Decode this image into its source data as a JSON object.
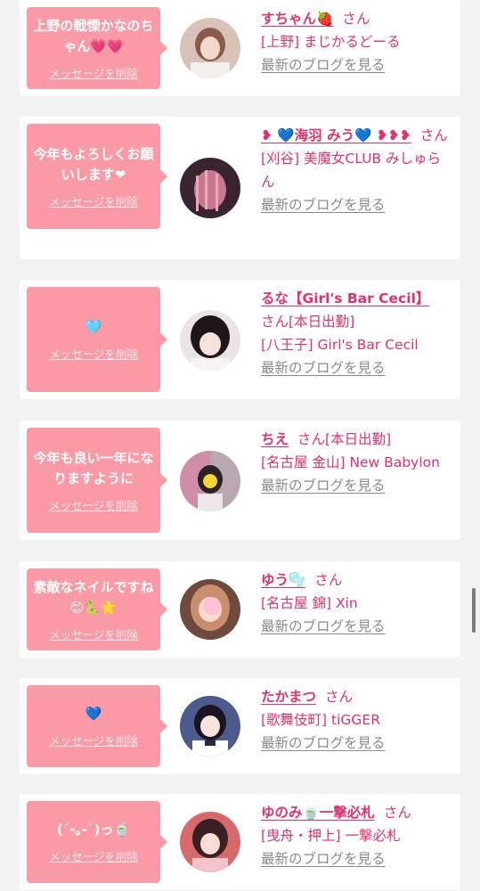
{
  "delete_label": "メッセージを削除",
  "blog_label": "最新のブログを見る",
  "san_label": "さん",
  "colors": {
    "bubble": "#f99aa6",
    "name": "#e0336a",
    "blog_link": "#8a8a8a",
    "card": "#ffffff",
    "background": "#f2f2f2"
  },
  "messages": [
    {
      "text": "上野の戦慄かなのちゃん💗💗",
      "name": "すちゃん🍓",
      "suffix": "",
      "shop": "[上野] まじかるどーる"
    },
    {
      "text": "今年もよろしくお願いします❤︎",
      "name": "❥ 💙海羽 みう💙 ❥❥❥",
      "suffix": "",
      "shop": "[刈谷] 美魔女CLUB みしゅらん"
    },
    {
      "text": "🩵",
      "name": "るな【Girl's Bar Cecil】",
      "suffix": "[本日出勤]",
      "shop": "[八王子] Girl's Bar Cecil"
    },
    {
      "text": "今年も良い一年になりますように",
      "name": "ちえ",
      "suffix": "[本日出勤]",
      "shop": "[名古屋 金山] New Babylon"
    },
    {
      "text": "素敵なネイルですね😊🐍🌟",
      "name": "ゆう🫧",
      "suffix": "",
      "shop": "[名古屋 錦] Xin"
    },
    {
      "text": "💙",
      "name": "たかまつ",
      "suffix": "",
      "shop": "[歌舞伎町] tiGGER"
    },
    {
      "text": "(´-｡-`)っ🍵",
      "name": "ゆのみ🍵一撃必札",
      "suffix": "",
      "shop": "[曳舟・押上] 一撃必札"
    }
  ]
}
